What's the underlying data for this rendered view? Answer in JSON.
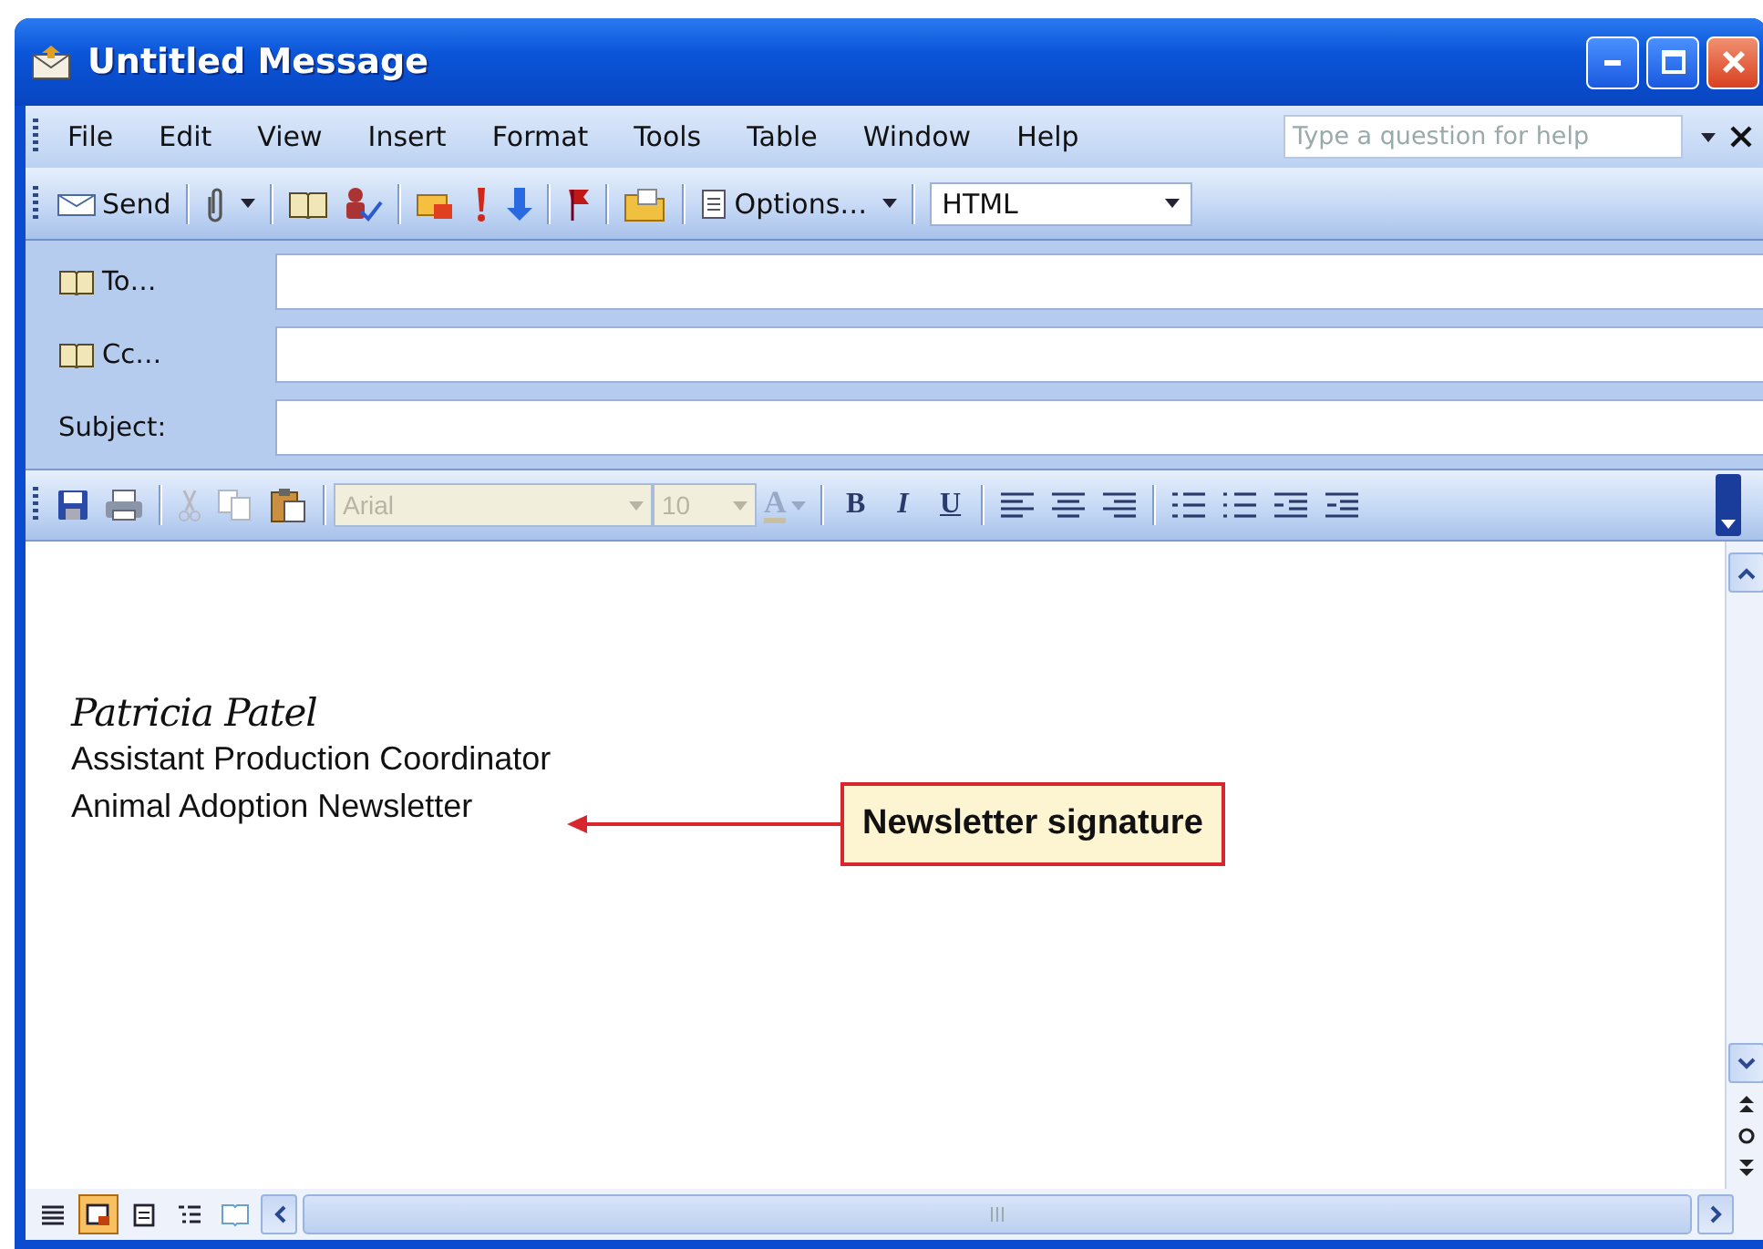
{
  "window": {
    "title": "Untitled Message"
  },
  "menu": [
    {
      "label": "File"
    },
    {
      "label": "Edit"
    },
    {
      "label": "View"
    },
    {
      "label": "Insert"
    },
    {
      "label": "Format"
    },
    {
      "label": "Tools"
    },
    {
      "label": "Table"
    },
    {
      "label": "Window"
    },
    {
      "label": "Help"
    }
  ],
  "help_box": {
    "placeholder": "Type a question for help"
  },
  "standard_toolbar": {
    "send": "Send",
    "options": "Options…",
    "message_format": {
      "value": "HTML"
    }
  },
  "address_fields": [
    {
      "label": "To…",
      "kind": "book"
    },
    {
      "label": "Cc…",
      "kind": "book"
    },
    {
      "label": "Subject:",
      "kind": "plain"
    }
  ],
  "format_toolbar": {
    "font": {
      "value": "Arial",
      "disabled": true
    },
    "size": {
      "value": "10",
      "disabled": true
    },
    "font_color": "A",
    "styles": [
      "B",
      "I",
      "U"
    ]
  },
  "body": {
    "lines": [
      {
        "text": "Patricia Patel",
        "kind": "script"
      },
      {
        "text": "Assistant Production Coordinator",
        "kind": "plain"
      },
      {
        "text": "Animal Adoption Newsletter",
        "kind": "plain"
      }
    ]
  },
  "callout": {
    "text": "Newsletter signature"
  },
  "view_buttons": [
    {
      "selected": false
    },
    {
      "selected": true
    },
    {
      "selected": false
    },
    {
      "selected": false
    },
    {
      "selected": false
    }
  ]
}
